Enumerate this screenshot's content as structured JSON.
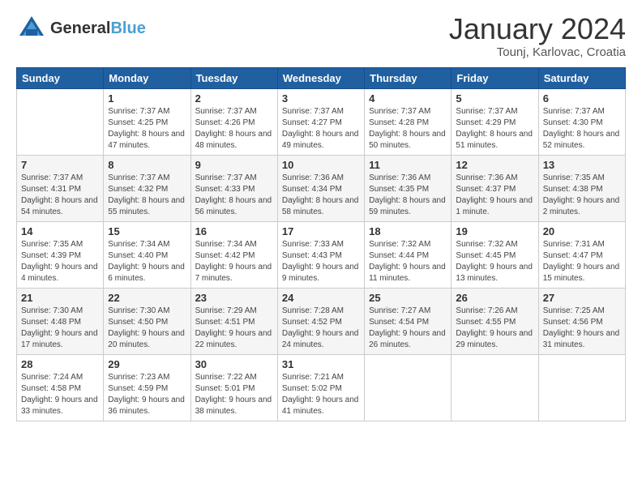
{
  "header": {
    "logo_general": "General",
    "logo_blue": "Blue",
    "month": "January 2024",
    "location": "Tounj, Karlovac, Croatia"
  },
  "days_of_week": [
    "Sunday",
    "Monday",
    "Tuesday",
    "Wednesday",
    "Thursday",
    "Friday",
    "Saturday"
  ],
  "weeks": [
    [
      {
        "day": "",
        "sunrise": "",
        "sunset": "",
        "daylight": ""
      },
      {
        "day": "1",
        "sunrise": "Sunrise: 7:37 AM",
        "sunset": "Sunset: 4:25 PM",
        "daylight": "Daylight: 8 hours and 47 minutes."
      },
      {
        "day": "2",
        "sunrise": "Sunrise: 7:37 AM",
        "sunset": "Sunset: 4:26 PM",
        "daylight": "Daylight: 8 hours and 48 minutes."
      },
      {
        "day": "3",
        "sunrise": "Sunrise: 7:37 AM",
        "sunset": "Sunset: 4:27 PM",
        "daylight": "Daylight: 8 hours and 49 minutes."
      },
      {
        "day": "4",
        "sunrise": "Sunrise: 7:37 AM",
        "sunset": "Sunset: 4:28 PM",
        "daylight": "Daylight: 8 hours and 50 minutes."
      },
      {
        "day": "5",
        "sunrise": "Sunrise: 7:37 AM",
        "sunset": "Sunset: 4:29 PM",
        "daylight": "Daylight: 8 hours and 51 minutes."
      },
      {
        "day": "6",
        "sunrise": "Sunrise: 7:37 AM",
        "sunset": "Sunset: 4:30 PM",
        "daylight": "Daylight: 8 hours and 52 minutes."
      }
    ],
    [
      {
        "day": "7",
        "sunrise": "Sunrise: 7:37 AM",
        "sunset": "Sunset: 4:31 PM",
        "daylight": "Daylight: 8 hours and 54 minutes."
      },
      {
        "day": "8",
        "sunrise": "Sunrise: 7:37 AM",
        "sunset": "Sunset: 4:32 PM",
        "daylight": "Daylight: 8 hours and 55 minutes."
      },
      {
        "day": "9",
        "sunrise": "Sunrise: 7:37 AM",
        "sunset": "Sunset: 4:33 PM",
        "daylight": "Daylight: 8 hours and 56 minutes."
      },
      {
        "day": "10",
        "sunrise": "Sunrise: 7:36 AM",
        "sunset": "Sunset: 4:34 PM",
        "daylight": "Daylight: 8 hours and 58 minutes."
      },
      {
        "day": "11",
        "sunrise": "Sunrise: 7:36 AM",
        "sunset": "Sunset: 4:35 PM",
        "daylight": "Daylight: 8 hours and 59 minutes."
      },
      {
        "day": "12",
        "sunrise": "Sunrise: 7:36 AM",
        "sunset": "Sunset: 4:37 PM",
        "daylight": "Daylight: 9 hours and 1 minute."
      },
      {
        "day": "13",
        "sunrise": "Sunrise: 7:35 AM",
        "sunset": "Sunset: 4:38 PM",
        "daylight": "Daylight: 9 hours and 2 minutes."
      }
    ],
    [
      {
        "day": "14",
        "sunrise": "Sunrise: 7:35 AM",
        "sunset": "Sunset: 4:39 PM",
        "daylight": "Daylight: 9 hours and 4 minutes."
      },
      {
        "day": "15",
        "sunrise": "Sunrise: 7:34 AM",
        "sunset": "Sunset: 4:40 PM",
        "daylight": "Daylight: 9 hours and 6 minutes."
      },
      {
        "day": "16",
        "sunrise": "Sunrise: 7:34 AM",
        "sunset": "Sunset: 4:42 PM",
        "daylight": "Daylight: 9 hours and 7 minutes."
      },
      {
        "day": "17",
        "sunrise": "Sunrise: 7:33 AM",
        "sunset": "Sunset: 4:43 PM",
        "daylight": "Daylight: 9 hours and 9 minutes."
      },
      {
        "day": "18",
        "sunrise": "Sunrise: 7:32 AM",
        "sunset": "Sunset: 4:44 PM",
        "daylight": "Daylight: 9 hours and 11 minutes."
      },
      {
        "day": "19",
        "sunrise": "Sunrise: 7:32 AM",
        "sunset": "Sunset: 4:45 PM",
        "daylight": "Daylight: 9 hours and 13 minutes."
      },
      {
        "day": "20",
        "sunrise": "Sunrise: 7:31 AM",
        "sunset": "Sunset: 4:47 PM",
        "daylight": "Daylight: 9 hours and 15 minutes."
      }
    ],
    [
      {
        "day": "21",
        "sunrise": "Sunrise: 7:30 AM",
        "sunset": "Sunset: 4:48 PM",
        "daylight": "Daylight: 9 hours and 17 minutes."
      },
      {
        "day": "22",
        "sunrise": "Sunrise: 7:30 AM",
        "sunset": "Sunset: 4:50 PM",
        "daylight": "Daylight: 9 hours and 20 minutes."
      },
      {
        "day": "23",
        "sunrise": "Sunrise: 7:29 AM",
        "sunset": "Sunset: 4:51 PM",
        "daylight": "Daylight: 9 hours and 22 minutes."
      },
      {
        "day": "24",
        "sunrise": "Sunrise: 7:28 AM",
        "sunset": "Sunset: 4:52 PM",
        "daylight": "Daylight: 9 hours and 24 minutes."
      },
      {
        "day": "25",
        "sunrise": "Sunrise: 7:27 AM",
        "sunset": "Sunset: 4:54 PM",
        "daylight": "Daylight: 9 hours and 26 minutes."
      },
      {
        "day": "26",
        "sunrise": "Sunrise: 7:26 AM",
        "sunset": "Sunset: 4:55 PM",
        "daylight": "Daylight: 9 hours and 29 minutes."
      },
      {
        "day": "27",
        "sunrise": "Sunrise: 7:25 AM",
        "sunset": "Sunset: 4:56 PM",
        "daylight": "Daylight: 9 hours and 31 minutes."
      }
    ],
    [
      {
        "day": "28",
        "sunrise": "Sunrise: 7:24 AM",
        "sunset": "Sunset: 4:58 PM",
        "daylight": "Daylight: 9 hours and 33 minutes."
      },
      {
        "day": "29",
        "sunrise": "Sunrise: 7:23 AM",
        "sunset": "Sunset: 4:59 PM",
        "daylight": "Daylight: 9 hours and 36 minutes."
      },
      {
        "day": "30",
        "sunrise": "Sunrise: 7:22 AM",
        "sunset": "Sunset: 5:01 PM",
        "daylight": "Daylight: 9 hours and 38 minutes."
      },
      {
        "day": "31",
        "sunrise": "Sunrise: 7:21 AM",
        "sunset": "Sunset: 5:02 PM",
        "daylight": "Daylight: 9 hours and 41 minutes."
      },
      {
        "day": "",
        "sunrise": "",
        "sunset": "",
        "daylight": ""
      },
      {
        "day": "",
        "sunrise": "",
        "sunset": "",
        "daylight": ""
      },
      {
        "day": "",
        "sunrise": "",
        "sunset": "",
        "daylight": ""
      }
    ]
  ]
}
